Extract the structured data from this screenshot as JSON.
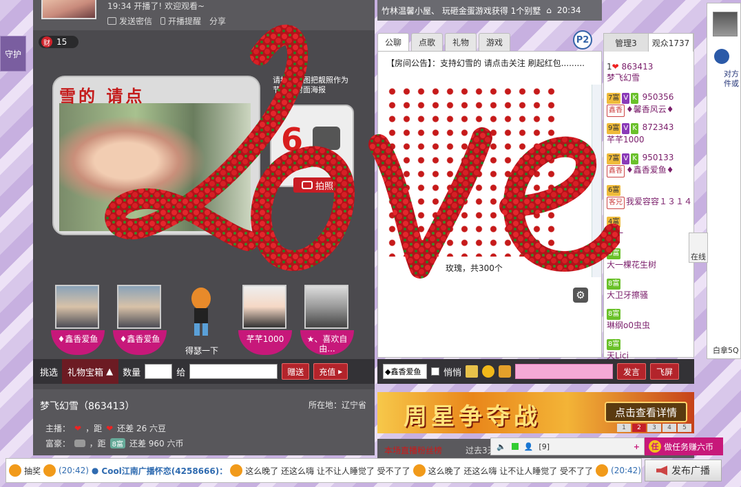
{
  "left_tab": {
    "label": "守护"
  },
  "host_top": {
    "time_line": "19:34 开播了! 欢迎观看~",
    "send_msg": "发送密信",
    "remind": "开播提醒",
    "share": "分享"
  },
  "treasure": {
    "badge": "财",
    "count": "15"
  },
  "video": {
    "overlay_text": "雪的 请点"
  },
  "poster": {
    "note": "请按下截图把靓照作为节目的封面海报",
    "photo_button": "拍照"
  },
  "guards": [
    {
      "name": "♦鑫香爱鱼"
    },
    {
      "name": "♦鑫香爱鱼"
    },
    {
      "caption": "得瑟一下"
    },
    {
      "name": "芊芊1000"
    },
    {
      "name": "★、喜欢自由..."
    }
  ],
  "giftbar": {
    "pick": "挑选",
    "gift_tab": "礼物宝箱",
    "qty_label": "数量",
    "to_label": "给",
    "give_btn": "赠送",
    "recharge_btn": "充值"
  },
  "hostinfo": {
    "name": "梦飞幻雪（863413）",
    "location": "所在地：辽宁省",
    "anchor_label": "主播：",
    "anchor_gap": "，距",
    "anchor_remain": "还差 26 六豆",
    "rich_label": "富豪：",
    "rich_gap": "，距",
    "rich_level": "8富",
    "rich_remain": "还差 960 六币"
  },
  "topnotice": {
    "text": "竹林温馨小屋、 玩砸金蛋游戏获得 1个别墅",
    "time": "20:34"
  },
  "chattabs": [
    {
      "label": "公聊"
    },
    {
      "label": "点歌"
    },
    {
      "label": "礼物"
    },
    {
      "label": "游戏"
    }
  ],
  "p2": {
    "label": "P2"
  },
  "chat": {
    "notice": "【房间公告】：支持幻雪的 请点击关注 刷起红包.........",
    "message": "玫瑰，共300个"
  },
  "chatinput": {
    "target": "◆鑫香爱鱼",
    "whisper": "悄悄",
    "send_btn": "发言",
    "fly_btn": "飞屏"
  },
  "banner": {
    "text": "周星争夺战",
    "detail_btn": "点击查看详情",
    "pages": [
      "1",
      "2",
      "3",
      "4",
      "5"
    ]
  },
  "bottomtabs": {
    "a": "本场直播粉丝榜",
    "b": "过去3天..."
  },
  "userlist": {
    "tabs": [
      {
        "label": "管理3"
      },
      {
        "label": "观众1737"
      }
    ],
    "users": [
      {
        "id": "863413",
        "name": "梦飞幻雪",
        "tags": [
          "1"
        ]
      },
      {
        "id": "950356",
        "name": "♦馨香风云♦",
        "tags": [
          "7富",
          "V",
          "K",
          "鑫香"
        ]
      },
      {
        "id": "872343",
        "name": "芊芊1000",
        "tags": [
          "9富",
          "V",
          "K"
        ]
      },
      {
        "id": "950133",
        "name": "♦鑫香爱鱼♦",
        "tags": [
          "7富",
          "V",
          "K",
          "鑫香"
        ]
      },
      {
        "id": "",
        "name": "我爱容容１３１４",
        "tags": [
          "6富",
          "客兄"
        ]
      },
      {
        "id": "",
        "name": "星一",
        "tags": [
          "4富"
        ]
      },
      {
        "id": "",
        "name": "大一棵花生树",
        "tags": [
          "8富"
        ]
      },
      {
        "id": "",
        "name": "大卫牙擦骚",
        "tags": [
          "8富"
        ]
      },
      {
        "id": "",
        "name": "琳纲o0虫虫",
        "tags": [
          "8富"
        ]
      },
      {
        "id": "",
        "name": "天Lici",
        "tags": [
          "8富"
        ]
      }
    ]
  },
  "farright": {
    "text": "对方件或",
    "sq": "白拿5Q",
    "online": "在线"
  },
  "mini": {
    "count": "[9]"
  },
  "task": {
    "icon": "任",
    "label": "做任务赚六币"
  },
  "ticker": {
    "prefix": "抽奖",
    "time1": "(20:42)",
    "user": "Cool江南广播怀恋(4258666)：",
    "msg1": "这么晚了 还这么嗨 让不让人睡觉了 受不了了",
    "msg2": "这么晚了 还这么嗨 让不让人睡觉了 受不了了",
    "time2": "(20:42)"
  },
  "broadcast": {
    "label": "发布广播"
  },
  "colors": {
    "accent": "#c7187a",
    "red": "#c41a1a",
    "stage": "#4b4a4e"
  }
}
